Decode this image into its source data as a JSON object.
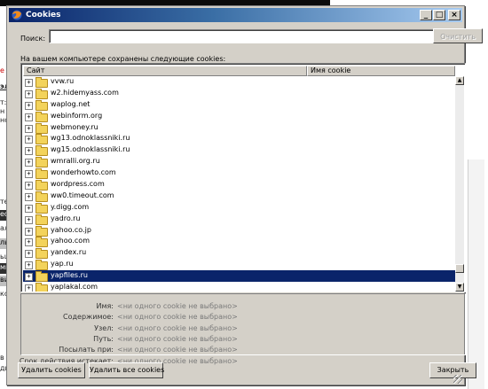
{
  "background": {
    "left_fragments": [
      "е",
      "эль",
      "т: 9",
      "н о",
      "но",
      "те",
      "ed",
      "аль",
      "ль",
      "ьш",
      "ми",
      "вит",
      "ко",
      "в с",
      "ди"
    ]
  },
  "window": {
    "title": "Cookies",
    "controls": {
      "minimize": "_",
      "maximize": "□",
      "close": "×"
    }
  },
  "search": {
    "label": "Поиск:",
    "value": "",
    "placeholder": "",
    "clear_label": "Очистить"
  },
  "intro_text": "На вашем компьютере сохранены следующие cookies:",
  "tree": {
    "columns": [
      "Сайт",
      "Имя cookie"
    ],
    "rows": [
      {
        "site": "vvw.ru",
        "selected": false
      },
      {
        "site": "w2.hidemyass.com",
        "selected": false
      },
      {
        "site": "waplog.net",
        "selected": false
      },
      {
        "site": "webinform.org",
        "selected": false
      },
      {
        "site": "webmoney.ru",
        "selected": false
      },
      {
        "site": "wg13.odnoklassniki.ru",
        "selected": false
      },
      {
        "site": "wg15.odnoklassniki.ru",
        "selected": false
      },
      {
        "site": "wmralli.org.ru",
        "selected": false
      },
      {
        "site": "wonderhowto.com",
        "selected": false
      },
      {
        "site": "wordpress.com",
        "selected": false
      },
      {
        "site": "ww0.timeout.com",
        "selected": false
      },
      {
        "site": "y.digg.com",
        "selected": false
      },
      {
        "site": "yadro.ru",
        "selected": false
      },
      {
        "site": "yahoo.co.jp",
        "selected": false
      },
      {
        "site": "yahoo.com",
        "selected": false
      },
      {
        "site": "yandex.ru",
        "selected": false
      },
      {
        "site": "yap.ru",
        "selected": false
      },
      {
        "site": "yapfiles.ru",
        "selected": true
      },
      {
        "site": "yaplakal.com",
        "selected": false
      }
    ],
    "scroll_position_fraction": 0.95
  },
  "details": [
    {
      "label": "Имя:",
      "value": "<ни одного cookie не выбрано>"
    },
    {
      "label": "Содержимое:",
      "value": "<ни одного cookie не выбрано>"
    },
    {
      "label": "Узел:",
      "value": "<ни одного cookie не выбрано>"
    },
    {
      "label": "Путь:",
      "value": "<ни одного cookie не выбрано>"
    },
    {
      "label": "Посылать при:",
      "value": "<ни одного cookie не выбрано>"
    },
    {
      "label": "Срок действия истекает:",
      "value": "<ни одного cookie не выбрано>"
    }
  ],
  "buttons": {
    "remove": "Удалить cookies",
    "remove_all": "Удалить все cookies",
    "close": "Закрыть"
  },
  "colors": {
    "selection": "#0a246a",
    "dialog_face": "#d4d0c8"
  }
}
